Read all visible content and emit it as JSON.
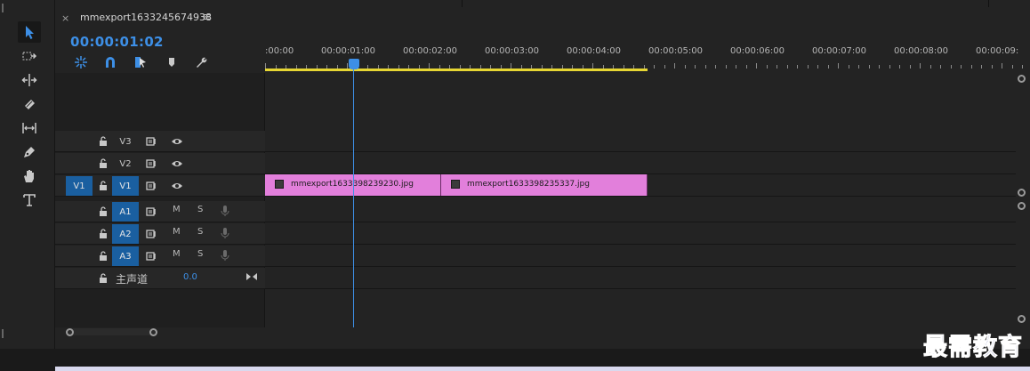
{
  "tab": {
    "close_glyph": "×",
    "title": "mmexport1633245674938",
    "menu_glyph": "≡"
  },
  "timecode": "00:00:01:02",
  "controls": [
    "snap-icon",
    "magnet-icon",
    "linked-selection-icon",
    "marker-icon",
    "wrench-icon"
  ],
  "tools": [
    "selection-tool-icon",
    "track-select-tool-icon",
    "ripple-edit-tool-icon",
    "razor-tool-icon",
    "slip-tool-icon",
    "pen-tool-icon",
    "hand-tool-icon",
    "type-tool-icon"
  ],
  "ruler": {
    "labels": [
      ":00:00",
      "00:00:01:00",
      "00:00:02:00",
      "00:00:03:00",
      "00:00:04:00",
      "00:00:05:00",
      "00:00:06:00",
      "00:00:07:00",
      "00:00:08:00",
      "00:00:09:"
    ]
  },
  "tracks": {
    "video": [
      {
        "name": "V3",
        "source": ""
      },
      {
        "name": "V2",
        "source": ""
      },
      {
        "name": "V1",
        "source": "V1"
      }
    ],
    "audio": [
      {
        "name": "A1",
        "mute": "M",
        "solo": "S"
      },
      {
        "name": "A2",
        "mute": "M",
        "solo": "S"
      },
      {
        "name": "A3",
        "mute": "M",
        "solo": "S"
      }
    ],
    "master": {
      "label": "主声道",
      "value": "0.0"
    }
  },
  "clips": [
    {
      "label": "mmexport1633398239230.jpg"
    },
    {
      "label": "mmexport1633398235337.jpg"
    }
  ],
  "watermark": "最需教育",
  "colors": {
    "accent": "#3d8fe6",
    "clip": "#e27fdb",
    "work_area": "#e6d633",
    "panel": "#232323"
  }
}
